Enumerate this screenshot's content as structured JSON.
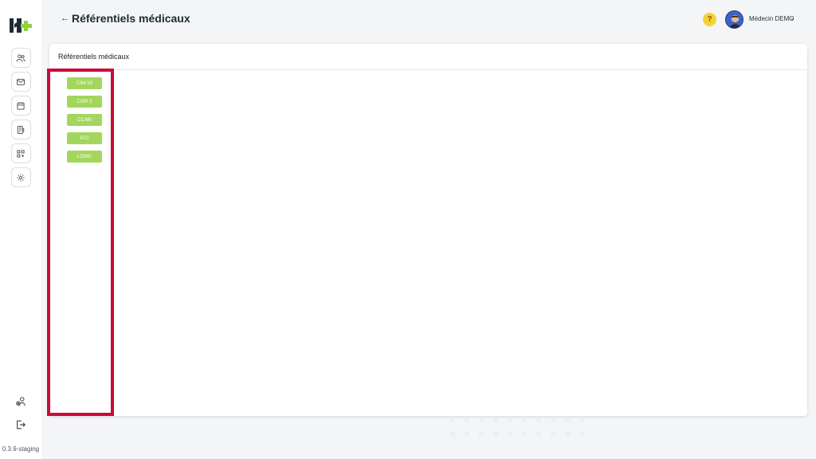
{
  "header": {
    "back_icon": "arrow-left-icon",
    "title": "Référentiels médicaux",
    "help_icon": "question-icon",
    "user_name": "Médecin DEMO",
    "user_menu_icon": "chevron-down-icon"
  },
  "sidebar": {
    "logo": "app-logo",
    "items": [
      {
        "name": "users",
        "icon": "users-icon"
      },
      {
        "name": "messages",
        "icon": "mail-icon"
      },
      {
        "name": "calendar",
        "icon": "calendar-icon"
      },
      {
        "name": "documents",
        "icon": "documents-icon"
      },
      {
        "name": "apps",
        "icon": "grid-icon"
      },
      {
        "name": "settings",
        "icon": "gear-icon"
      }
    ],
    "bottom": [
      {
        "name": "profile",
        "icon": "user-settings-icon"
      },
      {
        "name": "logout",
        "icon": "logout-icon"
      }
    ],
    "version": "0.3.9-staging"
  },
  "card": {
    "title": "Référentiels médicaux",
    "referentials": [
      "CIM-10",
      "CISP 2",
      "CCAM",
      "ATC",
      "LOINC"
    ]
  },
  "colors": {
    "accent_green": "#a3d65c",
    "highlight_red": "#cc0a3a",
    "help_yellow": "#f5d233"
  }
}
